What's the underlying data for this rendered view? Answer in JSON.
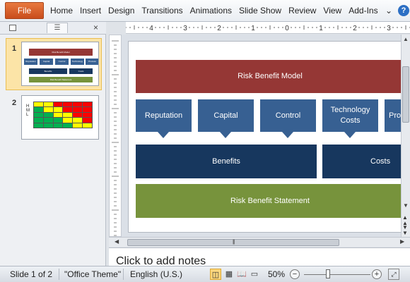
{
  "ribbon": {
    "file_label": "File",
    "tabs": [
      "Home",
      "Insert",
      "Design",
      "Transitions",
      "Animations",
      "Slide Show",
      "Review",
      "View",
      "Add-Ins"
    ],
    "minimize_icon": "chevron-down-icon",
    "help_label": "?"
  },
  "panel": {
    "tab_slides_icon": "slide-icon",
    "tab_outline_icon": "outline-icon",
    "close_label": "×",
    "thumbnails": [
      {
        "number": "1",
        "title": "Risk Benefit Model",
        "boxes": [
          "Reputation",
          "Capital",
          "Control",
          "Technology Costs",
          "Process"
        ],
        "bars": [
          "Benefits",
          "Costs"
        ],
        "statement": "Risk Benefit Statement"
      },
      {
        "number": "2",
        "y_labels": [
          "H",
          "M",
          "L"
        ],
        "x_labels": [
          "",
          "",
          "",
          "",
          ""
        ]
      }
    ]
  },
  "ruler": {
    "labels": [
      "4",
      "3",
      "2",
      "1",
      "0",
      "1",
      "2",
      "3"
    ]
  },
  "slide": {
    "title": "Risk Benefit Model",
    "callouts": [
      "Reputation",
      "Capital",
      "Control",
      "Technology Costs",
      "Pro"
    ],
    "benefits": "Benefits",
    "costs": "Costs",
    "statement": "Risk Benefit Statement"
  },
  "notes": {
    "placeholder": "Click to add notes"
  },
  "status": {
    "slide_info": "Slide 1 of 2",
    "theme": "\"Office Theme\"",
    "language": "English (U.S.)",
    "zoom": "50%",
    "zoom_fraction": 0.36
  },
  "colors": {
    "title_red": "#953735",
    "callout_blue": "#376092",
    "dark_blue": "#17375e",
    "statement_green": "#77933c",
    "heatmap": [
      "#ffff00",
      "#00b050",
      "#ff0000"
    ]
  }
}
